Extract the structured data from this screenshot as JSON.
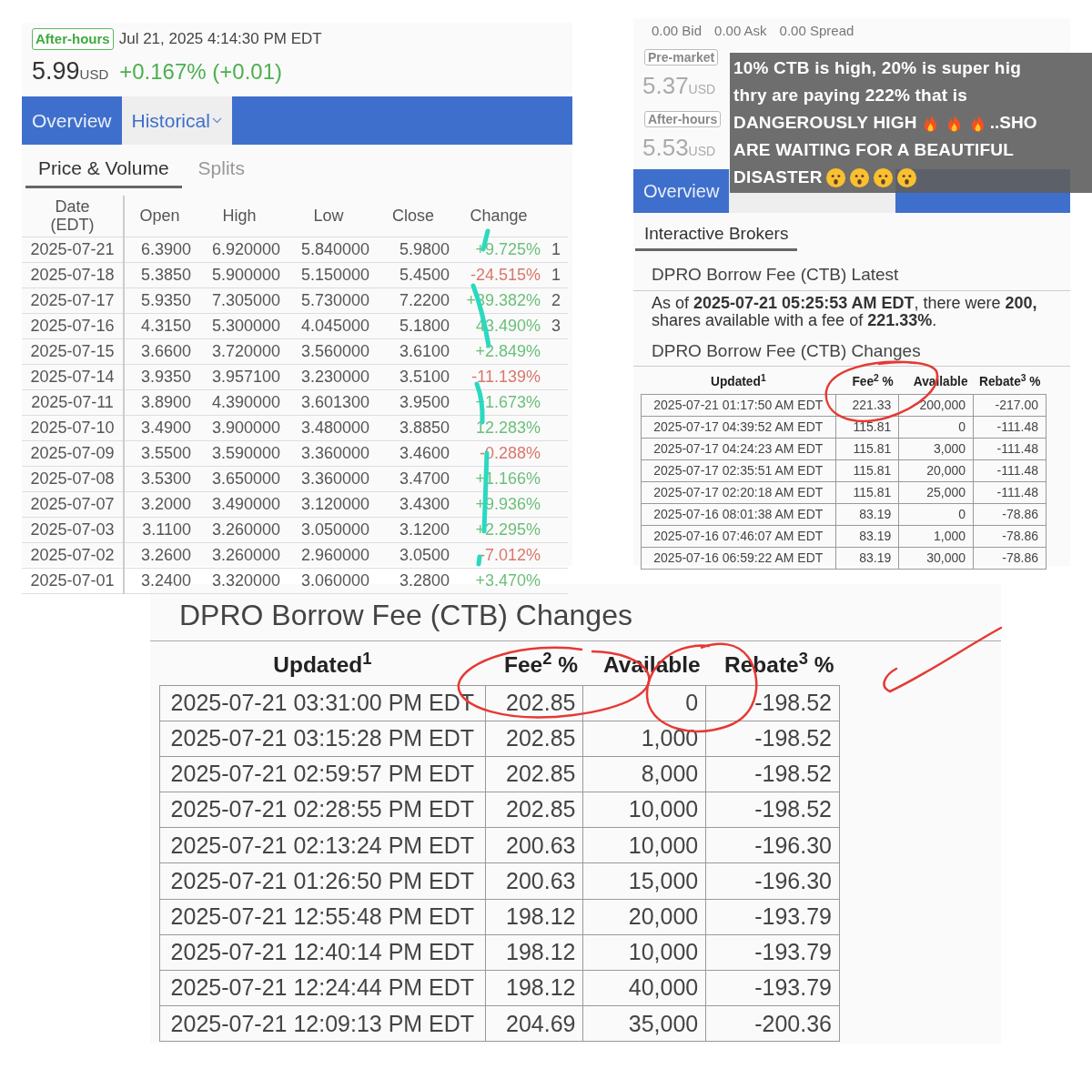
{
  "quote_panel": {
    "session_badge": "After-hours",
    "timestamp": "Jul 21, 2025 4:14:30 PM EDT",
    "price": "5.99",
    "currency": "USD",
    "change": "+0.167% (+0.01)",
    "tabs": [
      {
        "label": "Overview",
        "selected": false
      },
      {
        "label": "Historical",
        "selected": true
      }
    ],
    "subtabs": [
      {
        "label": "Price & Volume",
        "selected": true
      },
      {
        "label": "Splits",
        "selected": false
      }
    ],
    "table": {
      "columns": [
        "Date\n(EDT)",
        "Open",
        "High",
        "Low",
        "Close",
        "Change"
      ],
      "rows": [
        {
          "cells": [
            "2025-07-21",
            "6.3900",
            "6.920000",
            "5.840000",
            "5.9800",
            "+9.725%"
          ],
          "color": "#6cbf7a",
          "column_7": "1"
        },
        {
          "cells": [
            "2025-07-18",
            "5.3850",
            "5.900000",
            "5.150000",
            "5.4500",
            "-24.515%"
          ],
          "color": "#d9776b",
          "column_7": "1"
        },
        {
          "cells": [
            "2025-07-17",
            "5.9350",
            "7.305000",
            "5.730000",
            "7.2200",
            "+39.382%"
          ],
          "color": "#6cbf7a",
          "column_7": "2"
        },
        {
          "cells": [
            "2025-07-16",
            "4.3150",
            "5.300000",
            "4.045000",
            "5.1800",
            "43.490%"
          ],
          "color": "#6cbf7a",
          "column_7": "3"
        },
        {
          "cells": [
            "2025-07-15",
            "3.6600",
            "3.720000",
            "3.560000",
            "3.6100",
            "+2.849%"
          ],
          "color": "#6cbf7a"
        },
        {
          "cells": [
            "2025-07-14",
            "3.9350",
            "3.957100",
            "3.230000",
            "3.5100",
            "-11.139%"
          ],
          "color": "#d9776b"
        },
        {
          "cells": [
            "2025-07-11",
            "3.8900",
            "4.390000",
            "3.601300",
            "3.9500",
            "+1.673%"
          ],
          "color": "#6cbf7a"
        },
        {
          "cells": [
            "2025-07-10",
            "3.4900",
            "3.900000",
            "3.480000",
            "3.8850",
            "12.283%"
          ],
          "color": "#6cbf7a"
        },
        {
          "cells": [
            "2025-07-09",
            "3.5500",
            "3.590000",
            "3.360000",
            "3.4600",
            "-0.288%"
          ],
          "color": "#d9776b"
        },
        {
          "cells": [
            "2025-07-08",
            "3.5300",
            "3.650000",
            "3.360000",
            "3.4700",
            "+1.166%"
          ],
          "color": "#6cbf7a"
        },
        {
          "cells": [
            "2025-07-07",
            "3.2000",
            "3.490000",
            "3.120000",
            "3.4300",
            "+9.936%"
          ],
          "color": "#6cbf7a"
        },
        {
          "cells": [
            "2025-07-03",
            "3.1100",
            "3.260000",
            "3.050000",
            "3.1200",
            "+2.295%"
          ],
          "color": "#6cbf7a"
        },
        {
          "cells": [
            "2025-07-02",
            "3.2600",
            "3.260000",
            "2.960000",
            "3.0500",
            "-7.012%"
          ],
          "color": "#d9776b"
        },
        {
          "cells": [
            "2025-07-01",
            "3.2400",
            "3.320000",
            "3.060000",
            "3.2800",
            "+3.470%"
          ],
          "color": "#6cbf7a"
        }
      ]
    }
  },
  "borrow_panel": {
    "quote_stats": [
      "0.00 Bid",
      "0.00 Ask",
      "0.00 Spread"
    ],
    "sessions": [
      {
        "badge": "Pre-market",
        "price": "5.37",
        "currency": "USD"
      },
      {
        "badge": "After-hours",
        "price": "5.53",
        "currency": "USD"
      }
    ],
    "tabs": [
      {
        "label": "Overview",
        "selected": false
      },
      {
        "selected": true
      }
    ],
    "broker_tab": {
      "label": "Interactive Brokers",
      "selected": true
    },
    "latest": {
      "title": "DPRO Borrow Fee (CTB) Latest",
      "lines": [
        "As of **2025-07-21 05:25:53 AM EDT**, there were **200,**",
        "shares available with a fee of **221.33%**."
      ]
    },
    "changes": {
      "title": "DPRO Borrow Fee (CTB) Changes",
      "columns": [
        "Updated$^{1}$",
        "Fee$^{2}$ %",
        "Available",
        "Rebate$^{3}$ %"
      ],
      "rows": [
        [
          "2025-07-21 01:17:50 AM EDT",
          "221.33",
          "200,000",
          "-217.00"
        ],
        [
          "2025-07-17 04:39:52 AM EDT",
          "115.81",
          "0",
          "-111.48"
        ],
        [
          "2025-07-17 04:24:23 AM EDT",
          "115.81",
          "3,000",
          "-111.48"
        ],
        [
          "2025-07-17 02:35:51 AM EDT",
          "115.81",
          "20,000",
          "-111.48"
        ],
        [
          "2025-07-17 02:20:18 AM EDT",
          "115.81",
          "25,000",
          "-111.48"
        ],
        [
          "2025-07-16 08:01:38 AM EDT",
          "83.19",
          "0",
          "-78.86"
        ],
        [
          "2025-07-16 07:46:07 AM EDT",
          "83.19",
          "1,000",
          "-78.86"
        ],
        [
          "2025-07-16 06:59:22 AM EDT",
          "83.19",
          "30,000",
          "-78.86"
        ]
      ]
    }
  },
  "caption": {
    "lines": [
      {
        "text": "10% CTB is high, 20% is super hig"
      },
      {
        "text": "thry are paying 222% that is"
      },
      {
        "text": "DANGEROUSLY HIGH",
        "emojis": [
          {
            "kind": "flame"
          },
          {
            "kind": "flame"
          },
          {
            "kind": "flame"
          }
        ],
        "after": "..SHO"
      },
      {
        "text": "ARE WAITING FOR A BEAUTIFUL"
      },
      {
        "text": "DISASTER",
        "emojis": [
          {
            "kind": "face"
          },
          {
            "kind": "face"
          },
          {
            "kind": "face"
          },
          {
            "kind": "face"
          }
        ]
      }
    ]
  },
  "zoomed_changes": {
    "title": "DPRO Borrow Fee (CTB) Changes",
    "columns": [
      "Updated$^{1}$",
      "Fee$^{2}$ %",
      "Available",
      "Rebate$^{3}$ %"
    ],
    "rows": [
      [
        "2025-07-21 03:31:00 PM EDT",
        "202.85",
        "0",
        "-198.52"
      ],
      [
        "2025-07-21 03:15:28 PM EDT",
        "202.85",
        "1,000",
        "-198.52"
      ],
      [
        "2025-07-21 02:59:57 PM EDT",
        "202.85",
        "8,000",
        "-198.52"
      ],
      [
        "2025-07-21 02:28:55 PM EDT",
        "202.85",
        "10,000",
        "-198.52"
      ],
      [
        "2025-07-21 02:13:24 PM EDT",
        "200.63",
        "10,000",
        "-196.30"
      ],
      [
        "2025-07-21 01:26:50 PM EDT",
        "200.63",
        "15,000",
        "-196.30"
      ],
      [
        "2025-07-21 12:55:48 PM EDT",
        "198.12",
        "20,000",
        "-193.79"
      ],
      [
        "2025-07-21 12:40:14 PM EDT",
        "198.12",
        "10,000",
        "-193.79"
      ],
      [
        "2025-07-21 12:24:44 PM EDT",
        "198.12",
        "40,000",
        "-193.79"
      ],
      [
        "2025-07-21 12:09:13 PM EDT",
        "204.69",
        "35,000",
        "-200.36"
      ]
    ]
  }
}
